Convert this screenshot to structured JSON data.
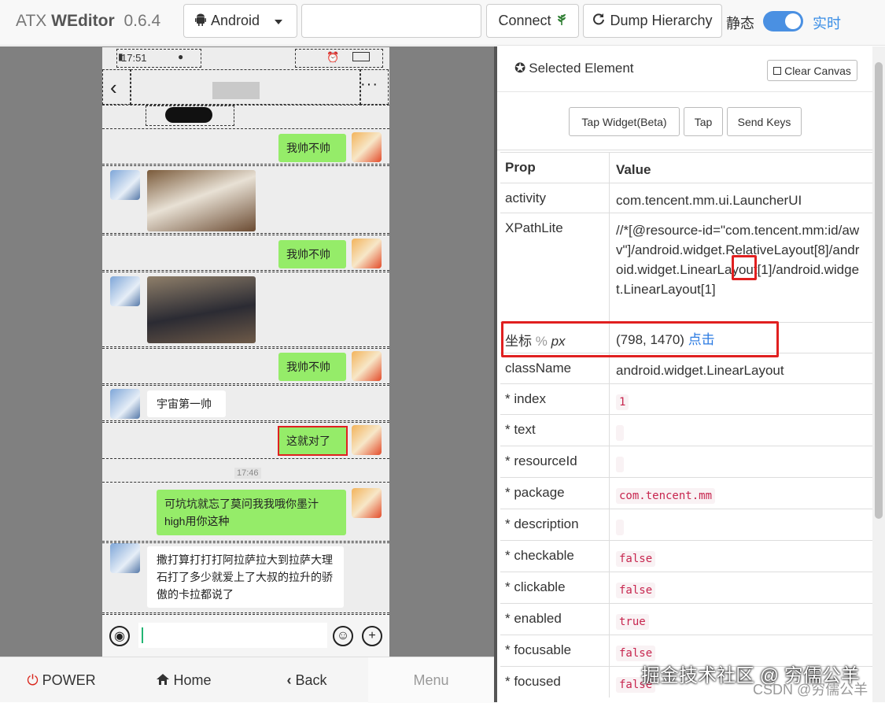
{
  "app": {
    "name_prefix": "ATX",
    "name_bold": "WEditor",
    "version": "0.6.4"
  },
  "toolbar": {
    "platform": "Android",
    "serial_placeholder": "",
    "connect_label": "Connect",
    "dump_label": "Dump Hierarchy",
    "static_label": "静态",
    "live_label": "实时",
    "live_enabled": true
  },
  "phone": {
    "status_time": "17:51",
    "messages": [
      {
        "side": "right",
        "text": "我帅不帅"
      },
      {
        "side": "left",
        "type": "image"
      },
      {
        "side": "right",
        "text": "我帅不帅"
      },
      {
        "side": "left",
        "type": "image"
      },
      {
        "side": "right",
        "text": "我帅不帅"
      },
      {
        "side": "left",
        "text": "宇宙第一帅"
      },
      {
        "side": "right",
        "text": "这就对了"
      },
      {
        "side": "right",
        "text": "可坑坑就忘了莫问我我哦你墨汁 high用你这种"
      },
      {
        "side": "left",
        "text": "撒打算打打打阿拉萨拉大到拉萨大理石打了多少就爱上了大叔的拉升的骄傲的卡拉都说了"
      }
    ],
    "timestamp": "17:46"
  },
  "bottom_nav": {
    "power": "POWER",
    "home": "Home",
    "back": "Back",
    "menu": "Menu"
  },
  "inspector": {
    "title": "Selected Element",
    "clear_label": "Clear Canvas",
    "actions": {
      "tap_widget": "Tap Widget(Beta)",
      "tap": "Tap",
      "send_keys": "Send Keys"
    },
    "headers": {
      "prop": "Prop",
      "value": "Value"
    },
    "activity": {
      "prop": "activity",
      "value": "com.tencent.mm.ui.LauncherUI"
    },
    "xpath": {
      "prop": "XPathLite",
      "value": "//*[@resource-id=\"com.tencent.mm:id/awv\"]/android.widget.RelativeLayout[8]/android.widget.LinearLayout[1]/android.widget.LinearLayout[1]"
    },
    "coords": {
      "prop": "坐标",
      "pct": "%",
      "px": "px",
      "value": "(798, 1470)",
      "action": "点击"
    },
    "classname": {
      "prop": "className",
      "value": "android.widget.LinearLayout"
    },
    "attrs": [
      {
        "prop": "* index",
        "value": "1"
      },
      {
        "prop": "* text",
        "value": ""
      },
      {
        "prop": "* resourceId",
        "value": ""
      },
      {
        "prop": "* package",
        "value": "com.tencent.mm"
      },
      {
        "prop": "* description",
        "value": ""
      },
      {
        "prop": "* checkable",
        "value": "false"
      },
      {
        "prop": "* clickable",
        "value": "false"
      },
      {
        "prop": "* enabled",
        "value": "true"
      },
      {
        "prop": "* focusable",
        "value": "false"
      },
      {
        "prop": "* focused",
        "value": "false"
      }
    ]
  },
  "watermark": {
    "main": "掘金技术社区 @ 穷儒公羊",
    "sub": "CSDN @穷儒公羊"
  },
  "colors": {
    "accent": "#4a90e2",
    "highlight": "#e02020",
    "bubble_green": "#95ec69"
  }
}
